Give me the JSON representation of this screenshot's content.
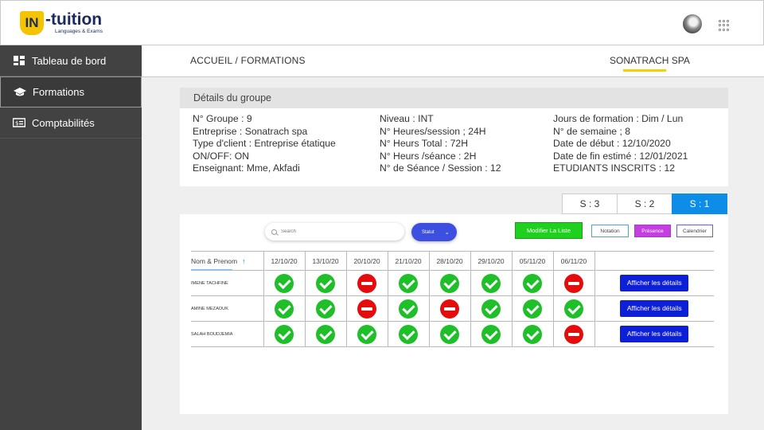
{
  "header": {
    "logo_mark": "IN",
    "logo_name": "-tuition",
    "logo_sub": "Languages & Exams"
  },
  "sidebar": {
    "items": [
      {
        "label": "Tableau de bord",
        "icon": "dashboard-icon"
      },
      {
        "label": "Formations",
        "icon": "graduation-cap-icon",
        "active": true
      },
      {
        "label": "Comptabilités",
        "icon": "money-icon"
      }
    ]
  },
  "topbar": {
    "breadcrumb": "ACCUEIL / FORMATIONS",
    "company": "SONATRACH SPA"
  },
  "details": {
    "title": "Détails du groupe",
    "col1": [
      "N° Groupe : 9",
      "Entreprise : Sonatrach spa",
      "Type d'client : Entreprise étatique",
      "ON/OFF: ON",
      "Enseignant: Mme, Akfadi"
    ],
    "col2": [
      "Niveau : INT",
      "N° Heures/session  ; 24H",
      "N° Heurs Total : 72H",
      "N° Heurs /séance : 2H",
      "N° de Séance / Session : 12"
    ],
    "col3": [
      "Jours de formation : Dim / Lun",
      "N° de semaine  ; 8",
      "Date de début : 12/10/2020",
      "Date de fin estimé : 12/01/2021",
      "ETUDIANTS INSCRITS : 12"
    ]
  },
  "sessions": [
    "S : 3",
    "S : 2",
    "S : 1"
  ],
  "toolbar": {
    "search_placeholder": "Search",
    "statut_label": "Statut",
    "modify_label": "Modifier La Liste",
    "notation_label": "Notation",
    "presence_label": "Présence",
    "calendrier_label": "Calendrier"
  },
  "table": {
    "name_header": "Nom & Prenom",
    "dates": [
      "12/10/20",
      "13/10/20",
      "20/10/20",
      "21/10/20",
      "28/10/20",
      "29/10/20",
      "05/11/20",
      "06/11/20"
    ],
    "action_label": "Afficher les détails",
    "rows": [
      {
        "name": "IMENE TACHFINE",
        "attendance": [
          true,
          true,
          false,
          true,
          true,
          true,
          true,
          false
        ]
      },
      {
        "name": "AMINE MEZAOUK",
        "attendance": [
          true,
          true,
          false,
          true,
          false,
          true,
          true,
          true
        ]
      },
      {
        "name": "SALAH BOUDJEMIA",
        "attendance": [
          true,
          true,
          true,
          true,
          true,
          true,
          true,
          false
        ]
      }
    ]
  },
  "colors": {
    "brand_yellow": "#f5c400",
    "active_tab": "#0d8de8",
    "present": "#1fbf2a",
    "absent": "#e50c0c",
    "details_button": "#0e1fd8"
  }
}
